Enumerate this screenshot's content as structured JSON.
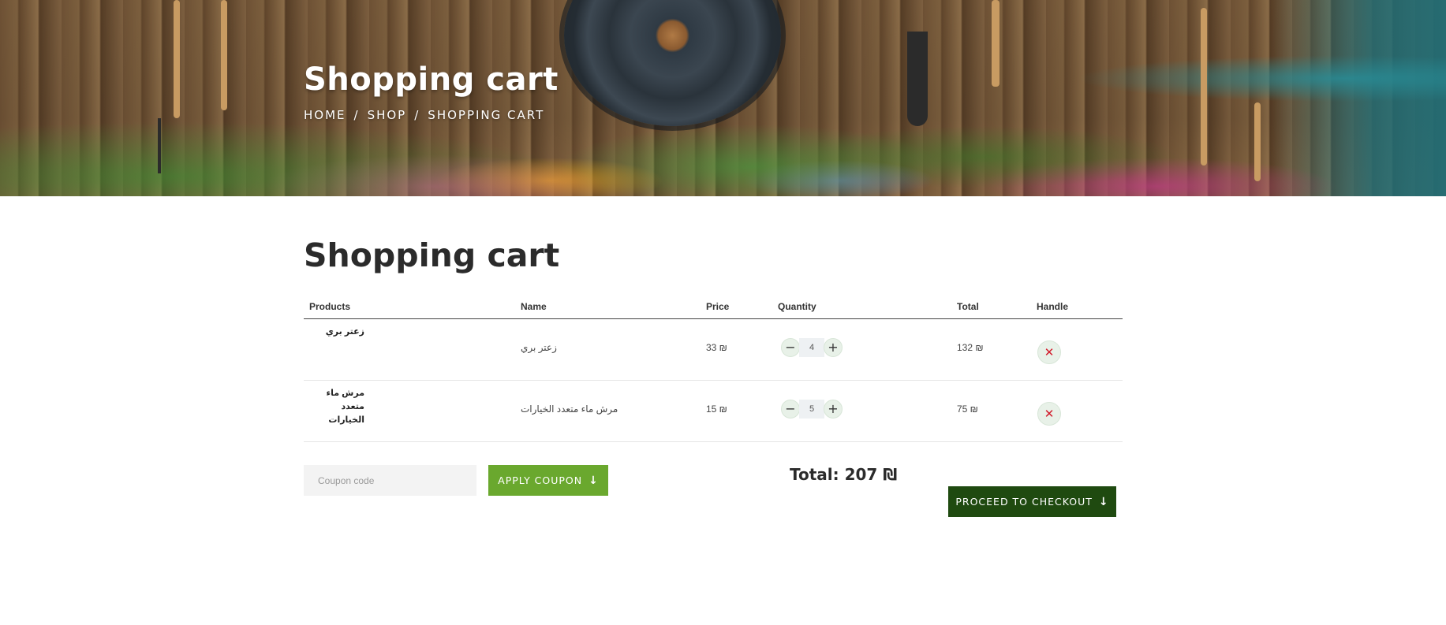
{
  "hero": {
    "title": "Shopping cart",
    "breadcrumb": [
      {
        "label": "HOME"
      },
      {
        "label": "SHOP"
      },
      {
        "label": "SHOPPING CART"
      }
    ],
    "separator": "/"
  },
  "main": {
    "title": "Shopping cart"
  },
  "table": {
    "headers": {
      "products": "Products",
      "name": "Name",
      "price": "Price",
      "quantity": "Quantity",
      "total": "Total",
      "handle": "Handle"
    },
    "rows": [
      {
        "image_text": "زعتر بري",
        "name": "زعتر بري",
        "price": "33 ₪",
        "quantity": "4",
        "total": "132 ₪"
      },
      {
        "image_text": "مرش ماء متعدد الخيارات",
        "name": "مرش ماء متعدد الخيارات",
        "price": "15 ₪",
        "quantity": "5",
        "total": "75 ₪"
      }
    ],
    "minus_symbol": "−",
    "plus_symbol": "+",
    "remove_symbol": "✕"
  },
  "coupon": {
    "placeholder": "Coupon code",
    "value": "",
    "button_label": "APPLY COUPON"
  },
  "summary": {
    "total_label": "Total: 207 ₪"
  },
  "checkout": {
    "button_label": "PROCEED TO CHECKOUT"
  },
  "icons": {
    "arrow": "↓"
  },
  "colors": {
    "apply_button": "#6aa82e",
    "checkout_button": "#1f4a10",
    "remove_icon": "#d11a2a"
  }
}
